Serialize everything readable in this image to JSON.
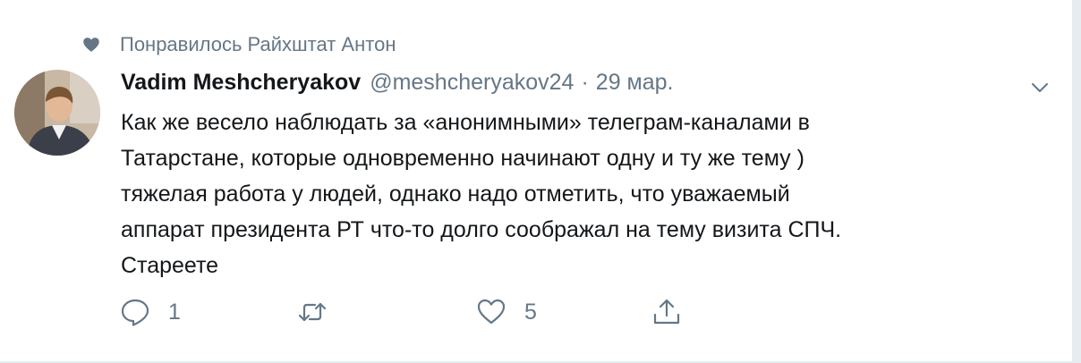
{
  "social_context": {
    "text": "Понравилось Райхштат Антон",
    "icon": "heart-icon"
  },
  "tweet": {
    "author_name": "Vadim Meshcheryakov",
    "handle": "@meshcheryakov24",
    "separator": "·",
    "date": "29 мар.",
    "text": "Как же весело наблюдать за «анонимными» телеграм-каналами в\nТатарстане, которые одновременно начинают одну и ту же тему )\nтяжелая работа у людей, однако надо отметить, что уважаемый\nаппарат президента РТ что-то долго соображал на тему визита СПЧ.\nСтареете"
  },
  "actions": {
    "reply": {
      "icon": "reply-icon",
      "count": "1"
    },
    "retweet": {
      "icon": "retweet-icon",
      "count": ""
    },
    "like": {
      "icon": "like-heart-icon",
      "count": "5"
    },
    "share": {
      "icon": "share-icon",
      "count": ""
    }
  },
  "colors": {
    "text": "#14171a",
    "secondary": "#657786",
    "divider": "#e6ecf0"
  }
}
